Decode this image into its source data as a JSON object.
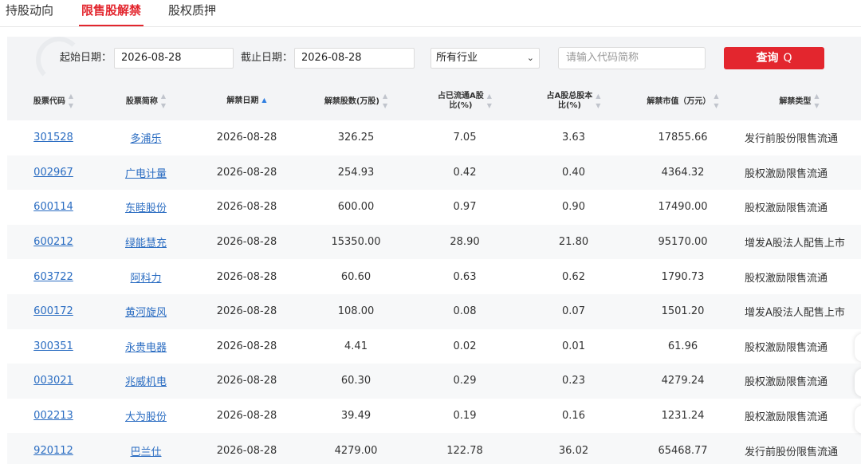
{
  "tabs": [
    "持股动向",
    "限售股解禁",
    "股权质押"
  ],
  "active_tab": 1,
  "filter": {
    "start_label": "起始日期：",
    "start_value": "2026-08-28",
    "end_label": "截止日期：",
    "end_value": "2026-08-28",
    "industry_value": "所有行业",
    "search_placeholder": "请输入代码简称",
    "query_label": "查询",
    "query_icon": "Q"
  },
  "columns": [
    {
      "label": "股票代码",
      "sort": "none"
    },
    {
      "label": "股票简称",
      "sort": "none"
    },
    {
      "label": "解禁日期",
      "sort": "asc"
    },
    {
      "label": "解禁股数(万股)",
      "sort": "none"
    },
    {
      "label_line1": "占已流通A股",
      "label_line2": "比(%)",
      "sort": "none"
    },
    {
      "label_line1": "占A股总股本",
      "label_line2": "比(%)",
      "sort": "none"
    },
    {
      "label": "解禁市值（万元）",
      "sort": "none"
    },
    {
      "label": "解禁类型",
      "sort": "none"
    }
  ],
  "rows": [
    [
      "301528",
      "多浦乐",
      "2026-08-28",
      "326.25",
      "7.05",
      "3.63",
      "17855.66",
      "发行前股份限售流通"
    ],
    [
      "002967",
      "广电计量",
      "2026-08-28",
      "254.93",
      "0.42",
      "0.40",
      "4364.32",
      "股权激励限售流通"
    ],
    [
      "600114",
      "东睦股份",
      "2026-08-28",
      "600.00",
      "0.97",
      "0.90",
      "17490.00",
      "股权激励限售流通"
    ],
    [
      "600212",
      "绿能慧充",
      "2026-08-28",
      "15350.00",
      "28.90",
      "21.80",
      "95170.00",
      "增发A股法人配售上市"
    ],
    [
      "603722",
      "阿科力",
      "2026-08-28",
      "60.60",
      "0.63",
      "0.62",
      "1790.73",
      "股权激励限售流通"
    ],
    [
      "600172",
      "黄河旋风",
      "2026-08-28",
      "108.00",
      "0.08",
      "0.07",
      "1501.20",
      "增发A股法人配售上市"
    ],
    [
      "300351",
      "永贵电器",
      "2026-08-28",
      "4.41",
      "0.02",
      "0.01",
      "61.96",
      "股权激励限售流通"
    ],
    [
      "003021",
      "兆威机电",
      "2026-08-28",
      "60.30",
      "0.29",
      "0.23",
      "4279.24",
      "股权激励限售流通"
    ],
    [
      "002213",
      "大为股份",
      "2026-08-28",
      "39.49",
      "0.19",
      "0.16",
      "1231.24",
      "股权激励限售流通"
    ],
    [
      "920112",
      "巴兰仕",
      "2026-08-28",
      "4279.00",
      "122.78",
      "36.02",
      "65468.77",
      "发行前股份限售流通"
    ]
  ],
  "colors": {
    "accent": "#e3262e",
    "link": "#2b6dc2",
    "header_bg": "#f3f4f6"
  }
}
